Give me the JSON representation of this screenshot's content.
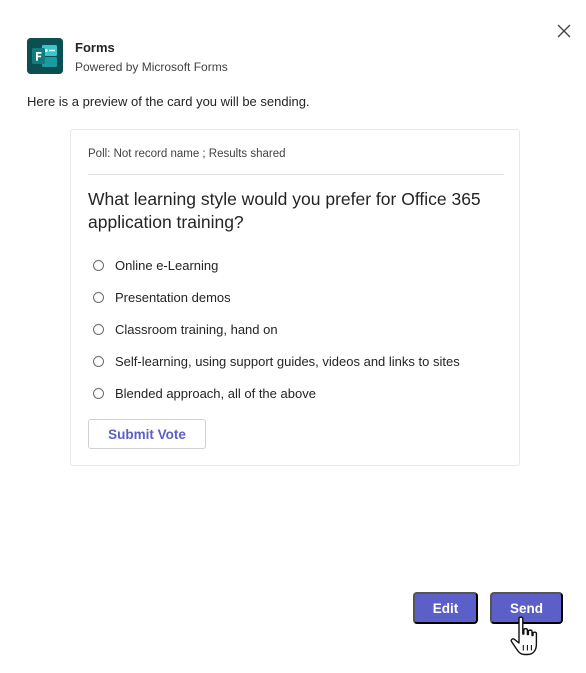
{
  "dialog": {
    "close_icon": "close-icon",
    "app": {
      "name": "Forms",
      "subtitle": "Powered by Microsoft Forms",
      "logo_icon": "microsoft-forms-icon",
      "logo_color": "#0c5a5c"
    },
    "preview_text": "Here is a preview of the card you will be sending."
  },
  "card": {
    "meta": "Poll: Not record name ; Results shared",
    "question": "What learning style would you prefer for Office 365 application training?",
    "options": [
      {
        "label": "Online e-Learning",
        "selected": false
      },
      {
        "label": "Presentation demos",
        "selected": false
      },
      {
        "label": "Classroom training, hand on",
        "selected": false
      },
      {
        "label": "Self-learning, using support guides, videos and links to sites",
        "selected": false
      },
      {
        "label": "Blended approach, all of the above",
        "selected": false
      }
    ],
    "submit_label": "Submit Vote"
  },
  "footer": {
    "edit_label": "Edit",
    "send_label": "Send"
  },
  "colors": {
    "accent": "#5b5fc7",
    "text": "#242424"
  }
}
